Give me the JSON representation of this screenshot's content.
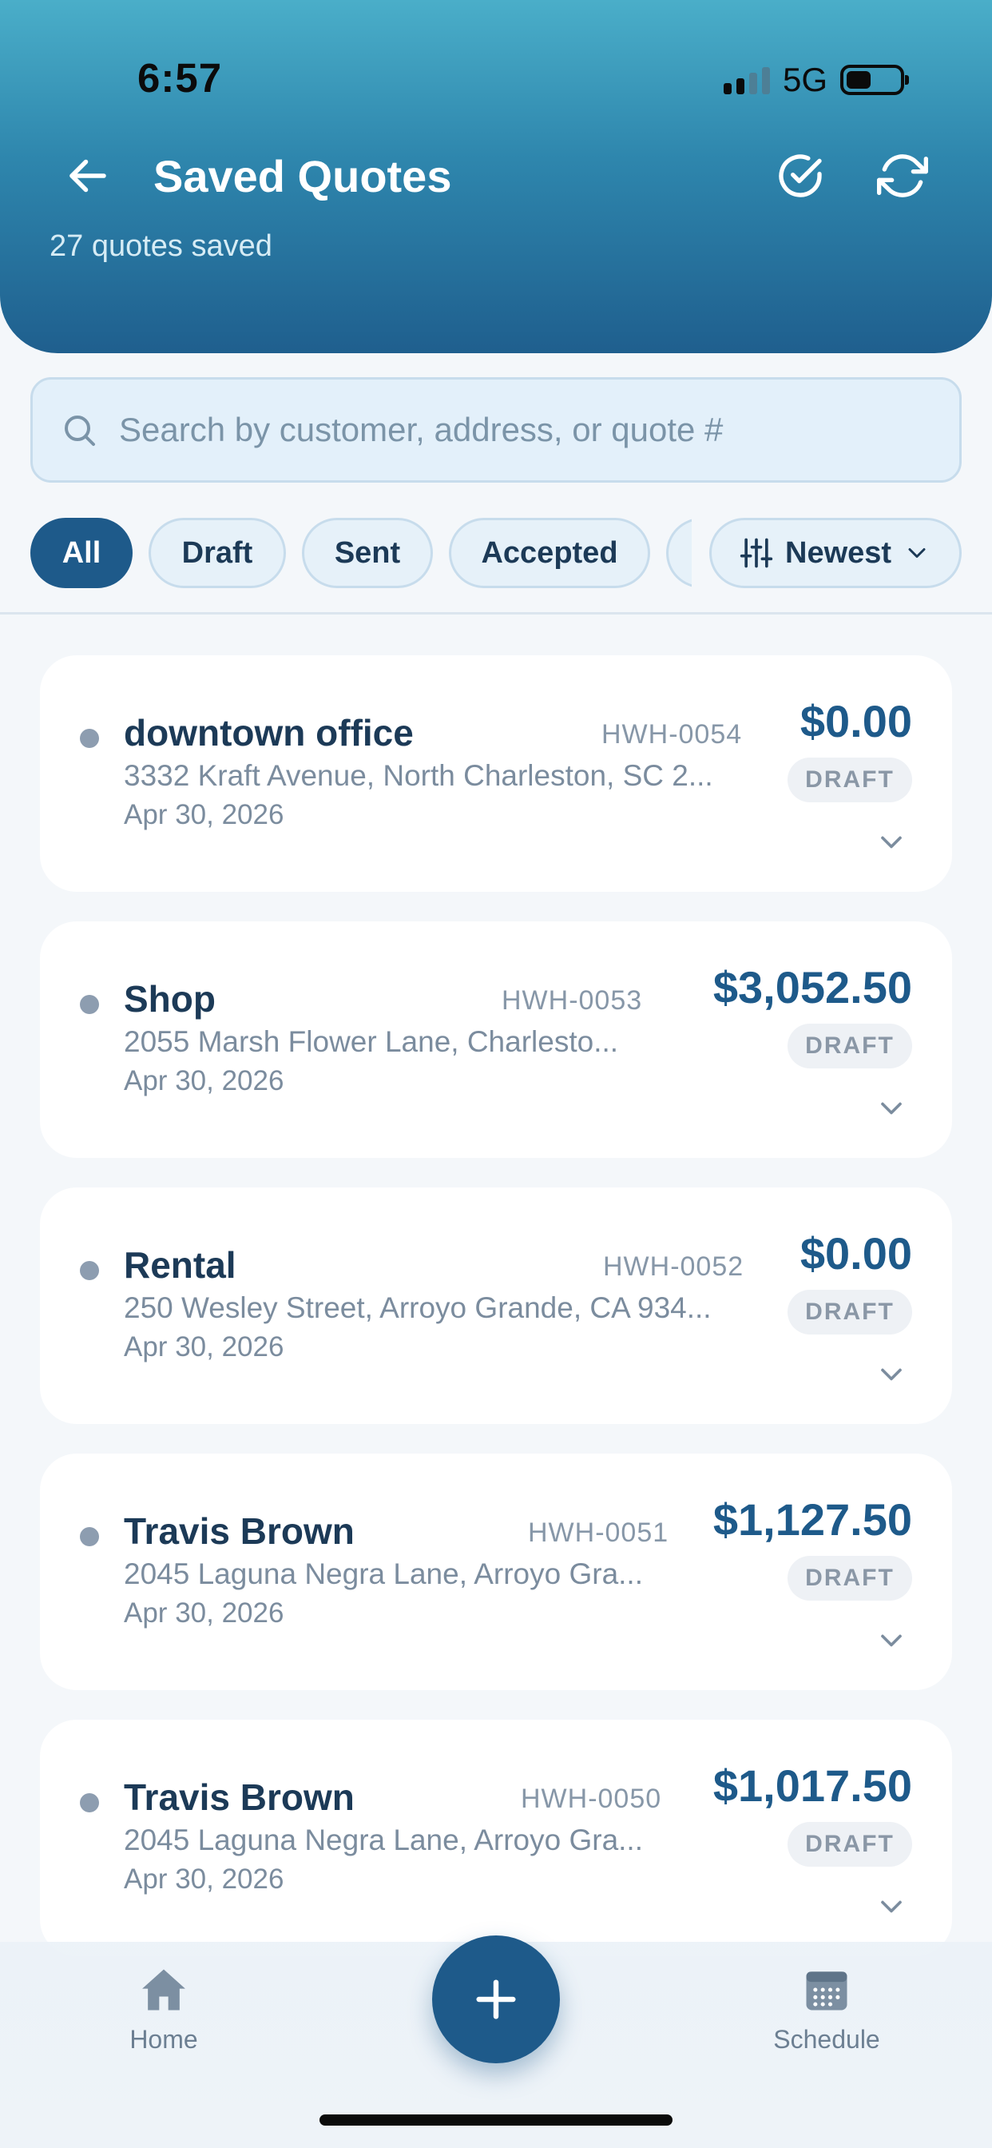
{
  "status_bar": {
    "time": "6:57",
    "network": "5G"
  },
  "header": {
    "title": "Saved Quotes",
    "subtitle": "27 quotes saved",
    "icons": [
      "back-arrow-icon",
      "check-circle-icon",
      "refresh-icon"
    ]
  },
  "search": {
    "placeholder": "Search by customer, address, or quote #",
    "value": ""
  },
  "filters": {
    "chips": [
      {
        "label": "All",
        "active": true
      },
      {
        "label": "Draft",
        "active": false
      },
      {
        "label": "Sent",
        "active": false
      },
      {
        "label": "Accepted",
        "active": false
      }
    ],
    "sort_label": "Newest"
  },
  "quotes": [
    {
      "name": "downtown office",
      "number": "HWH-0054",
      "address": "3332 Kraft Avenue, North Charleston, SC 2...",
      "date": "Apr 30, 2026",
      "amount": "$0.00",
      "status": "DRAFT"
    },
    {
      "name": "Shop",
      "number": "HWH-0053",
      "address": "2055 Marsh Flower Lane, Charlesto...",
      "date": "Apr 30, 2026",
      "amount": "$3,052.50",
      "status": "DRAFT"
    },
    {
      "name": "Rental",
      "number": "HWH-0052",
      "address": "250 Wesley Street, Arroyo Grande, CA 934...",
      "date": "Apr 30, 2026",
      "amount": "$0.00",
      "status": "DRAFT"
    },
    {
      "name": "Travis Brown",
      "number": "HWH-0051",
      "address": "2045 Laguna Negra Lane, Arroyo Gra...",
      "date": "Apr 30, 2026",
      "amount": "$1,127.50",
      "status": "DRAFT"
    },
    {
      "name": "Travis Brown",
      "number": "HWH-0050",
      "address": "2045 Laguna Negra Lane, Arroyo Gra...",
      "date": "Apr 30, 2026",
      "amount": "$1,017.50",
      "status": "DRAFT"
    }
  ],
  "bottom_nav": {
    "home_label": "Home",
    "schedule_label": "Schedule"
  },
  "colors": {
    "primary": "#1e5a8a",
    "header_top": "#4aaec9",
    "header_bottom": "#1f5f8e",
    "badge_bg": "#eef1f5"
  }
}
